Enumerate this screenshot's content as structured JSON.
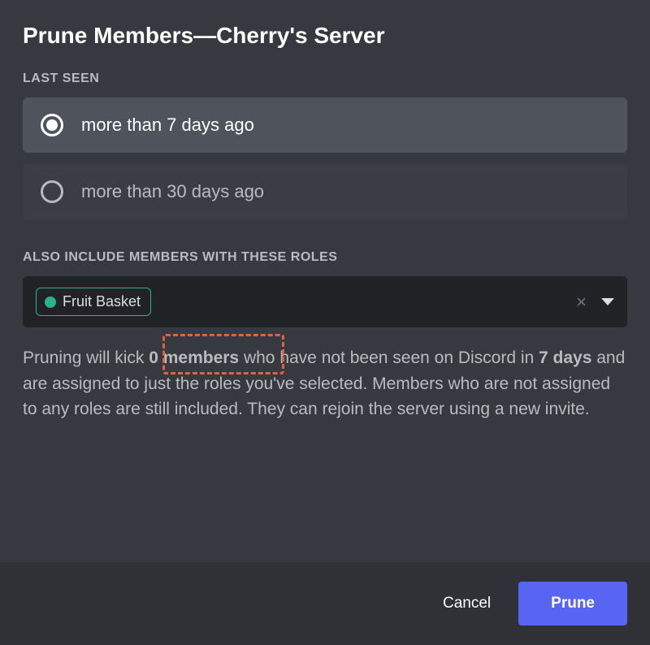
{
  "title": "Prune Members—Cherry's Server",
  "lastSeen": {
    "label": "LAST SEEN",
    "options": [
      {
        "label": "more than 7 days ago",
        "selected": true
      },
      {
        "label": "more than 30 days ago",
        "selected": false
      }
    ]
  },
  "roles": {
    "label": "ALSO INCLUDE MEMBERS WITH THESE ROLES",
    "selected": [
      {
        "name": "Fruit Basket",
        "color": "#2bb18e"
      }
    ]
  },
  "description": {
    "prefix": "Pruning will kick ",
    "count": "0 members",
    "mid1": " who have not been seen on Discord in ",
    "days": "7 days",
    "suffix": " and are assigned to just the roles you've selected. Members who are not assigned to any roles are still included. They can rejoin the server using a new invite."
  },
  "footer": {
    "cancel": "Cancel",
    "prune": "Prune"
  }
}
